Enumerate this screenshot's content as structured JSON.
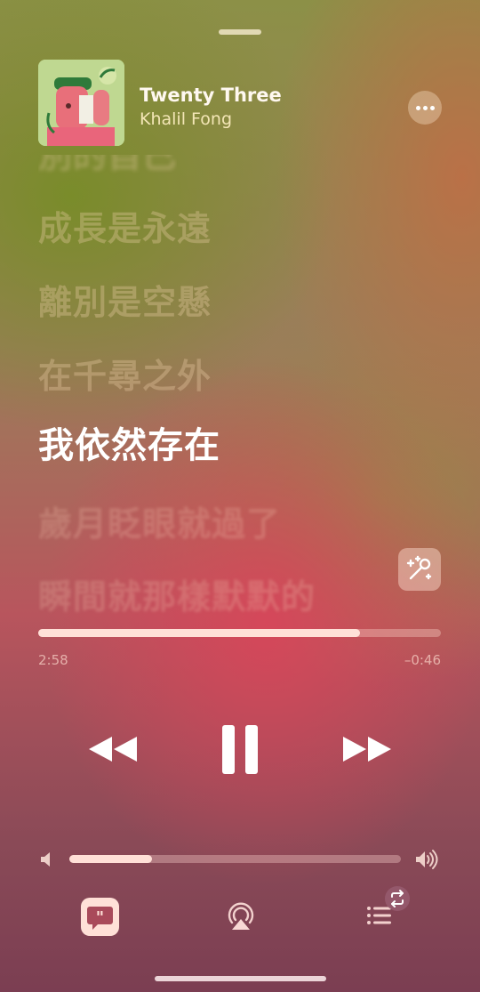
{
  "track": {
    "title": "Twenty Three",
    "artist": "Khalil Fong"
  },
  "lyrics": {
    "lines": [
      {
        "text": "別的自己",
        "state": "past-clipped"
      },
      {
        "text": "成長是永遠",
        "state": "past"
      },
      {
        "text": "離別是空懸",
        "state": "past"
      },
      {
        "text": "在千尋之外",
        "state": "past"
      },
      {
        "text": "我依然存在",
        "state": "current"
      },
      {
        "text": "歲月眨眼就過了",
        "state": "upcoming"
      },
      {
        "text": "瞬間就那樣默默的",
        "state": "upcoming"
      }
    ]
  },
  "playback": {
    "elapsed": "2:58",
    "remaining": "–0:46",
    "progress_fraction": 0.8,
    "state": "playing"
  },
  "volume": {
    "level_fraction": 0.25
  },
  "icons": {
    "more": "ellipsis-icon",
    "auto_lyrics": "magic-microphone-icon",
    "rewind": "rewind-icon",
    "pause": "pause-icon",
    "fast_forward": "fast-forward-icon",
    "volume_low": "speaker-low-icon",
    "volume_high": "speaker-high-icon",
    "lyrics": "lyrics-quote-icon",
    "airplay": "airplay-icon",
    "queue": "queue-list-icon",
    "repeat_badge": "repeat-icon"
  },
  "colors": {
    "text_primary": "#ffffff",
    "artist": "#f3e6b6",
    "accent_fill": "#ffe0d7"
  }
}
